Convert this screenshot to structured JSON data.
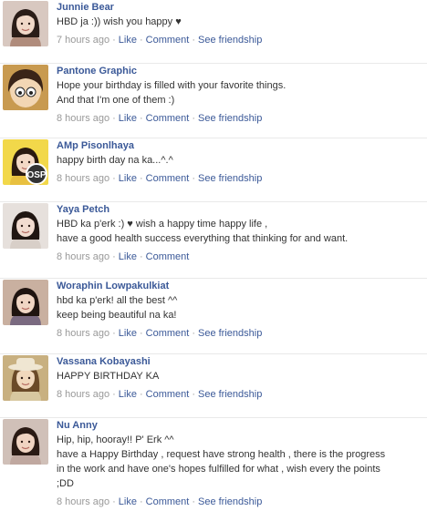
{
  "posts": [
    {
      "author": "Junnie Bear",
      "lines": [
        "HBD ja :)) wish you happy ♥"
      ],
      "time": "7 hours ago",
      "actions": [
        "Like",
        "Comment",
        "See friendship"
      ],
      "avatar": "woman-photo-avatar"
    },
    {
      "author": "Pantone Graphic",
      "lines": [
        "Hope your birthday is filled with your favorite things.",
        "And that I'm one of them :)"
      ],
      "time": "8 hours ago",
      "actions": [
        "Like",
        "Comment",
        "See friendship"
      ],
      "avatar": "cartoon-avatar"
    },
    {
      "author": "AMp Pisonlhaya",
      "lines": [
        "happy birth day na ka...^.^"
      ],
      "time": "8 hours ago",
      "actions": [
        "Like",
        "Comment",
        "See friendship"
      ],
      "avatar": "osp-badge-avatar",
      "badge_text": "OSP"
    },
    {
      "author": "Yaya Petch",
      "lines": [
        "HBD ka p'erk :) ♥ wish a happy time happy life ,",
        "have a good health success everything that thinking for and want."
      ],
      "time": "8 hours ago",
      "actions": [
        "Like",
        "Comment"
      ],
      "avatar": "woman-photo-avatar"
    },
    {
      "author": "Woraphin Lowpakulkiat",
      "lines": [
        "hbd ka p'erk! all the best ^^",
        "keep being beautiful na ka!"
      ],
      "time": "8 hours ago",
      "actions": [
        "Like",
        "Comment",
        "See friendship"
      ],
      "avatar": "woman-photo-avatar"
    },
    {
      "author": "Vassana Kobayashi",
      "lines": [
        "HAPPY BIRTHDAY KA"
      ],
      "time": "8 hours ago",
      "actions": [
        "Like",
        "Comment",
        "See friendship"
      ],
      "avatar": "woman-hat-photo-avatar"
    },
    {
      "author": "Nu Anny",
      "lines": [
        "Hip, hip, hooray!! P' Erk ^^",
        "have a Happy Birthday , request have strong health , there is the progress",
        "in the work and have one's hopes fulfilled for what , wish every the points",
        ";DD"
      ],
      "time": "8 hours ago",
      "actions": [
        "Like",
        "Comment",
        "See friendship"
      ],
      "avatar": "woman-photo-avatar"
    }
  ]
}
